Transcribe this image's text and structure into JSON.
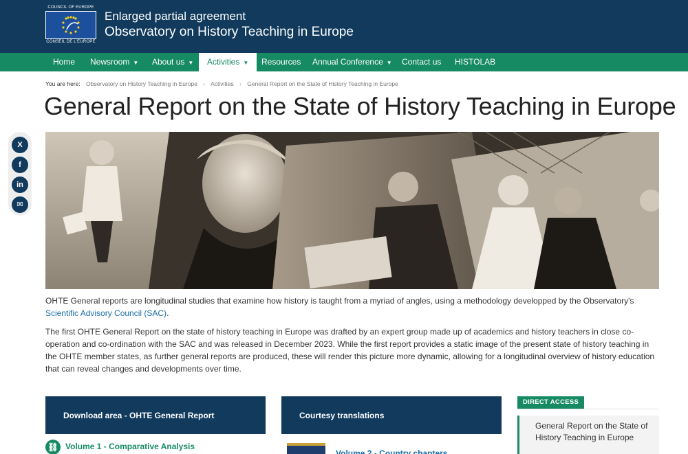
{
  "header": {
    "logo_top": "COUNCIL OF EUROPE",
    "logo_bottom": "CONSEIL DE L'EUROPE",
    "subtitle": "Enlarged partial agreement",
    "title": "Observatory on History Teaching in Europe"
  },
  "nav": {
    "items": [
      {
        "label": "Home",
        "dropdown": false
      },
      {
        "label": "Newsroom",
        "dropdown": true
      },
      {
        "label": "About us",
        "dropdown": true
      },
      {
        "label": "Activities",
        "dropdown": true,
        "active": true
      },
      {
        "label": "Resources",
        "dropdown": false
      },
      {
        "label": "Annual Conference",
        "dropdown": true
      },
      {
        "label": "Contact us",
        "dropdown": false
      },
      {
        "label": "HISTOLAB",
        "dropdown": false
      }
    ]
  },
  "breadcrumb": {
    "lead": "You are here:",
    "items": [
      "Observatory on History Teaching in Europe",
      "Activities",
      "General Report on the State of History Teaching in Europe"
    ]
  },
  "page": {
    "title": "General Report on the State of History Teaching in Europe"
  },
  "social": {
    "x": "X",
    "facebook": "f",
    "linkedin": "in",
    "email": "✉"
  },
  "content": {
    "p1_a": "OHTE General reports are longitudinal studies that examine how history is taught from a myriad of angles, using a methodology developped by the Observatory's ",
    "p1_link": "Scientific Advisory Council (SAC)",
    "p1_b": ".",
    "p2": "The first OHTE General Report on the state of history teaching in Europe was drafted by an expert group made up of academics and history teachers in close co-operation and co-ordination with the SAC and was released in December 2023. While the first report provides a static image of the present state of history teaching in the OHTE member states, as further general reports are produced, these will render this picture more dynamic, allowing for a longitudinal overview of history education that can reveal changes and developments over time."
  },
  "cards": {
    "download": "Download area - OHTE General Report",
    "translations": "Courtesy translations",
    "volume1": "Volume 1 - Comparative Analysis",
    "volume2": "Volume 2 - Country chapters"
  },
  "sidebar": {
    "tag": "DIRECT ACCESS",
    "item": "General Report on the State of History Teaching in Europe"
  },
  "colors": {
    "navy": "#113a5c",
    "green": "#168a63",
    "link": "#1a6fa8"
  }
}
